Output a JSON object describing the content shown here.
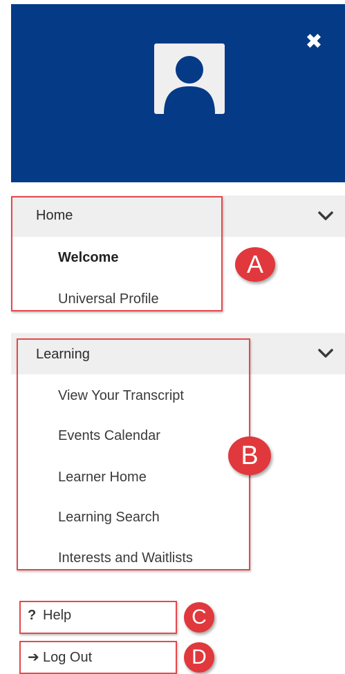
{
  "header": {
    "background_color": "#053a87",
    "avatar_icon": "user-avatar-icon",
    "close_icon": "close-icon",
    "close_symbol": "✖"
  },
  "nav": {
    "home": {
      "label": "Home",
      "items": [
        "Welcome",
        "Universal Profile"
      ]
    },
    "learning": {
      "label": "Learning",
      "items": [
        "View Your Transcript",
        "Events Calendar",
        "Learner Home",
        "Learning Search",
        "Interests and Waitlists"
      ]
    }
  },
  "utility": {
    "help_symbol": "?",
    "help_label": "Help",
    "logout_symbol": "➔",
    "logout_label": "Log Out"
  },
  "annotations": {
    "a": "A",
    "b": "B",
    "c": "C",
    "d": "D",
    "color": "#e0383c"
  }
}
